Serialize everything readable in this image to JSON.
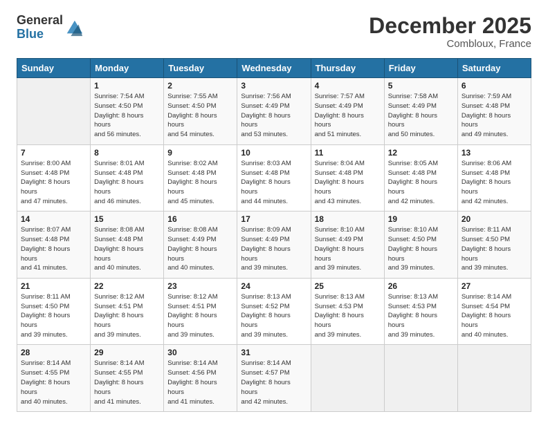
{
  "header": {
    "logo_general": "General",
    "logo_blue": "Blue",
    "month_title": "December 2025",
    "location": "Combloux, France"
  },
  "weekdays": [
    "Sunday",
    "Monday",
    "Tuesday",
    "Wednesday",
    "Thursday",
    "Friday",
    "Saturday"
  ],
  "weeks": [
    [
      {
        "day": "",
        "sunrise": "",
        "sunset": "",
        "daylight": "",
        "empty": true
      },
      {
        "day": "1",
        "sunrise": "7:54 AM",
        "sunset": "4:50 PM",
        "daylight": "8 hours and 56 minutes.",
        "empty": false
      },
      {
        "day": "2",
        "sunrise": "7:55 AM",
        "sunset": "4:50 PM",
        "daylight": "8 hours and 54 minutes.",
        "empty": false
      },
      {
        "day": "3",
        "sunrise": "7:56 AM",
        "sunset": "4:49 PM",
        "daylight": "8 hours and 53 minutes.",
        "empty": false
      },
      {
        "day": "4",
        "sunrise": "7:57 AM",
        "sunset": "4:49 PM",
        "daylight": "8 hours and 51 minutes.",
        "empty": false
      },
      {
        "day": "5",
        "sunrise": "7:58 AM",
        "sunset": "4:49 PM",
        "daylight": "8 hours and 50 minutes.",
        "empty": false
      },
      {
        "day": "6",
        "sunrise": "7:59 AM",
        "sunset": "4:48 PM",
        "daylight": "8 hours and 49 minutes.",
        "empty": false
      }
    ],
    [
      {
        "day": "7",
        "sunrise": "8:00 AM",
        "sunset": "4:48 PM",
        "daylight": "8 hours and 47 minutes.",
        "empty": false
      },
      {
        "day": "8",
        "sunrise": "8:01 AM",
        "sunset": "4:48 PM",
        "daylight": "8 hours and 46 minutes.",
        "empty": false
      },
      {
        "day": "9",
        "sunrise": "8:02 AM",
        "sunset": "4:48 PM",
        "daylight": "8 hours and 45 minutes.",
        "empty": false
      },
      {
        "day": "10",
        "sunrise": "8:03 AM",
        "sunset": "4:48 PM",
        "daylight": "8 hours and 44 minutes.",
        "empty": false
      },
      {
        "day": "11",
        "sunrise": "8:04 AM",
        "sunset": "4:48 PM",
        "daylight": "8 hours and 43 minutes.",
        "empty": false
      },
      {
        "day": "12",
        "sunrise": "8:05 AM",
        "sunset": "4:48 PM",
        "daylight": "8 hours and 42 minutes.",
        "empty": false
      },
      {
        "day": "13",
        "sunrise": "8:06 AM",
        "sunset": "4:48 PM",
        "daylight": "8 hours and 42 minutes.",
        "empty": false
      }
    ],
    [
      {
        "day": "14",
        "sunrise": "8:07 AM",
        "sunset": "4:48 PM",
        "daylight": "8 hours and 41 minutes.",
        "empty": false
      },
      {
        "day": "15",
        "sunrise": "8:08 AM",
        "sunset": "4:48 PM",
        "daylight": "8 hours and 40 minutes.",
        "empty": false
      },
      {
        "day": "16",
        "sunrise": "8:08 AM",
        "sunset": "4:49 PM",
        "daylight": "8 hours and 40 minutes.",
        "empty": false
      },
      {
        "day": "17",
        "sunrise": "8:09 AM",
        "sunset": "4:49 PM",
        "daylight": "8 hours and 39 minutes.",
        "empty": false
      },
      {
        "day": "18",
        "sunrise": "8:10 AM",
        "sunset": "4:49 PM",
        "daylight": "8 hours and 39 minutes.",
        "empty": false
      },
      {
        "day": "19",
        "sunrise": "8:10 AM",
        "sunset": "4:50 PM",
        "daylight": "8 hours and 39 minutes.",
        "empty": false
      },
      {
        "day": "20",
        "sunrise": "8:11 AM",
        "sunset": "4:50 PM",
        "daylight": "8 hours and 39 minutes.",
        "empty": false
      }
    ],
    [
      {
        "day": "21",
        "sunrise": "8:11 AM",
        "sunset": "4:50 PM",
        "daylight": "8 hours and 39 minutes.",
        "empty": false
      },
      {
        "day": "22",
        "sunrise": "8:12 AM",
        "sunset": "4:51 PM",
        "daylight": "8 hours and 39 minutes.",
        "empty": false
      },
      {
        "day": "23",
        "sunrise": "8:12 AM",
        "sunset": "4:51 PM",
        "daylight": "8 hours and 39 minutes.",
        "empty": false
      },
      {
        "day": "24",
        "sunrise": "8:13 AM",
        "sunset": "4:52 PM",
        "daylight": "8 hours and 39 minutes.",
        "empty": false
      },
      {
        "day": "25",
        "sunrise": "8:13 AM",
        "sunset": "4:53 PM",
        "daylight": "8 hours and 39 minutes.",
        "empty": false
      },
      {
        "day": "26",
        "sunrise": "8:13 AM",
        "sunset": "4:53 PM",
        "daylight": "8 hours and 39 minutes.",
        "empty": false
      },
      {
        "day": "27",
        "sunrise": "8:14 AM",
        "sunset": "4:54 PM",
        "daylight": "8 hours and 40 minutes.",
        "empty": false
      }
    ],
    [
      {
        "day": "28",
        "sunrise": "8:14 AM",
        "sunset": "4:55 PM",
        "daylight": "8 hours and 40 minutes.",
        "empty": false
      },
      {
        "day": "29",
        "sunrise": "8:14 AM",
        "sunset": "4:55 PM",
        "daylight": "8 hours and 41 minutes.",
        "empty": false
      },
      {
        "day": "30",
        "sunrise": "8:14 AM",
        "sunset": "4:56 PM",
        "daylight": "8 hours and 41 minutes.",
        "empty": false
      },
      {
        "day": "31",
        "sunrise": "8:14 AM",
        "sunset": "4:57 PM",
        "daylight": "8 hours and 42 minutes.",
        "empty": false
      },
      {
        "day": "",
        "sunrise": "",
        "sunset": "",
        "daylight": "",
        "empty": true
      },
      {
        "day": "",
        "sunrise": "",
        "sunset": "",
        "daylight": "",
        "empty": true
      },
      {
        "day": "",
        "sunrise": "",
        "sunset": "",
        "daylight": "",
        "empty": true
      }
    ]
  ]
}
